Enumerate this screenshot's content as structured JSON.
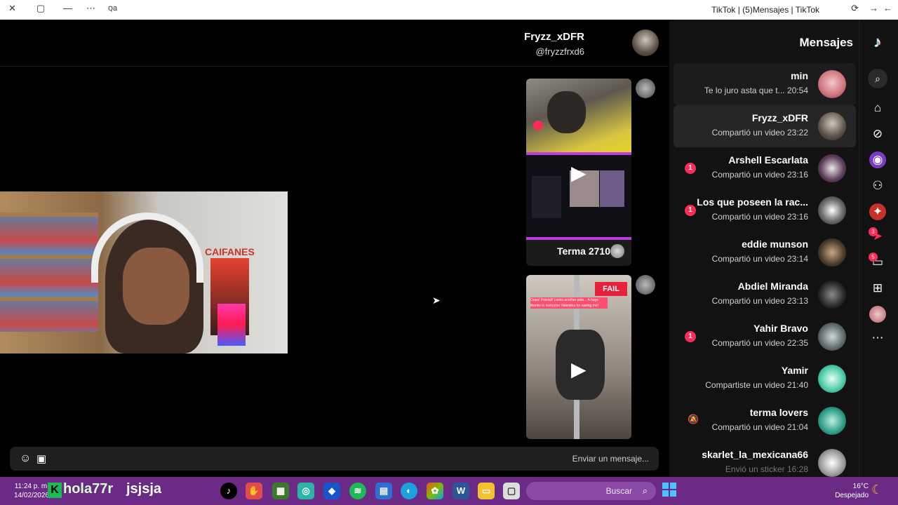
{
  "window": {
    "title": "TikTok | (5)Mensajes | TikTok"
  },
  "chat": {
    "header_name": "Fryzz_xDFR",
    "header_handle": "@fryzzfrxd6",
    "shared_video_1_caption": "Terma 2710",
    "shared_video_2_overlay": "FAIL",
    "shared_video_2_text": "Oops! Poisfall! Looks another pole... A huge thanks to instructor Valentina for saving me!",
    "stream_overlay_text": "CAIFANES",
    "composer_placeholder": "Enviar un mensaje..."
  },
  "sidebar": {
    "title": "Mensajes",
    "conversations": [
      {
        "name": "min",
        "preview": "Te lo juro asta que t... 20:54",
        "badge": ""
      },
      {
        "name": "Fryzz_xDFR",
        "preview": "Compartió un video 23:22",
        "badge": ""
      },
      {
        "name": "Arshell Escarlata",
        "preview": "Compartió un video 23:16",
        "badge": "1"
      },
      {
        "name": "Los que poseen la rac...",
        "preview": "Compartió un video 23:16",
        "badge": "1"
      },
      {
        "name": "eddie munson",
        "preview": "Compartió un video 23:14",
        "badge": ""
      },
      {
        "name": "Abdiel Miranda",
        "preview": "Compartió un video 23:13",
        "badge": ""
      },
      {
        "name": "Yahir Bravo",
        "preview": "Compartió un video 22:35",
        "badge": "1"
      },
      {
        "name": "Yamir",
        "preview": "Compartiste un video 21:40",
        "badge": ""
      },
      {
        "name": "terma lovers",
        "preview": "Compartió un video 21:04",
        "badge": ""
      },
      {
        "name": "skarlet_la_mexicana66",
        "preview": "Envió un sticker 16:28",
        "badge": ""
      }
    ]
  },
  "rail": {
    "inbox_badge": "3",
    "messages_badge": "5"
  },
  "taskbar": {
    "search_label": "Buscar",
    "weather_temp": "16°C",
    "weather_desc": "Despejado",
    "time": "11:24 p. m.",
    "date": "14/02/2026",
    "stream_text_1": "hola77r",
    "stream_text_2": "jsjsja",
    "k_letter": "K"
  },
  "colors": {
    "accent": "#fe2c55",
    "taskbar": "#6b2a86",
    "sidebar": "#121212"
  }
}
